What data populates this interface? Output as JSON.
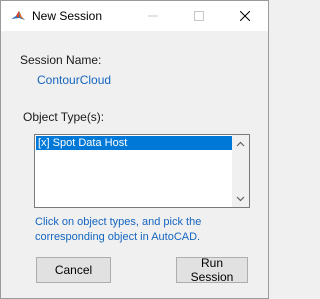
{
  "window": {
    "title": "New Session",
    "minimize_glyph": "—",
    "maximize_glyph": "☐",
    "close_glyph": "✕",
    "app_icon": "matlab-icon"
  },
  "session": {
    "name_label": "Session Name:",
    "name_value": "ContourCloud"
  },
  "object_types": {
    "label": "Object Type(s):",
    "items": [
      {
        "label": "[x] Spot Data Host",
        "selected": true
      }
    ]
  },
  "hint": {
    "line1": "Click on object types, and pick the",
    "line2": "corresponding object in AutoCAD."
  },
  "buttons": {
    "cancel_label": "Cancel",
    "run_label": "Run Session"
  },
  "colors": {
    "accent_text": "#1565c0",
    "selection": "#0078d7",
    "background": "#f0f0f0"
  }
}
